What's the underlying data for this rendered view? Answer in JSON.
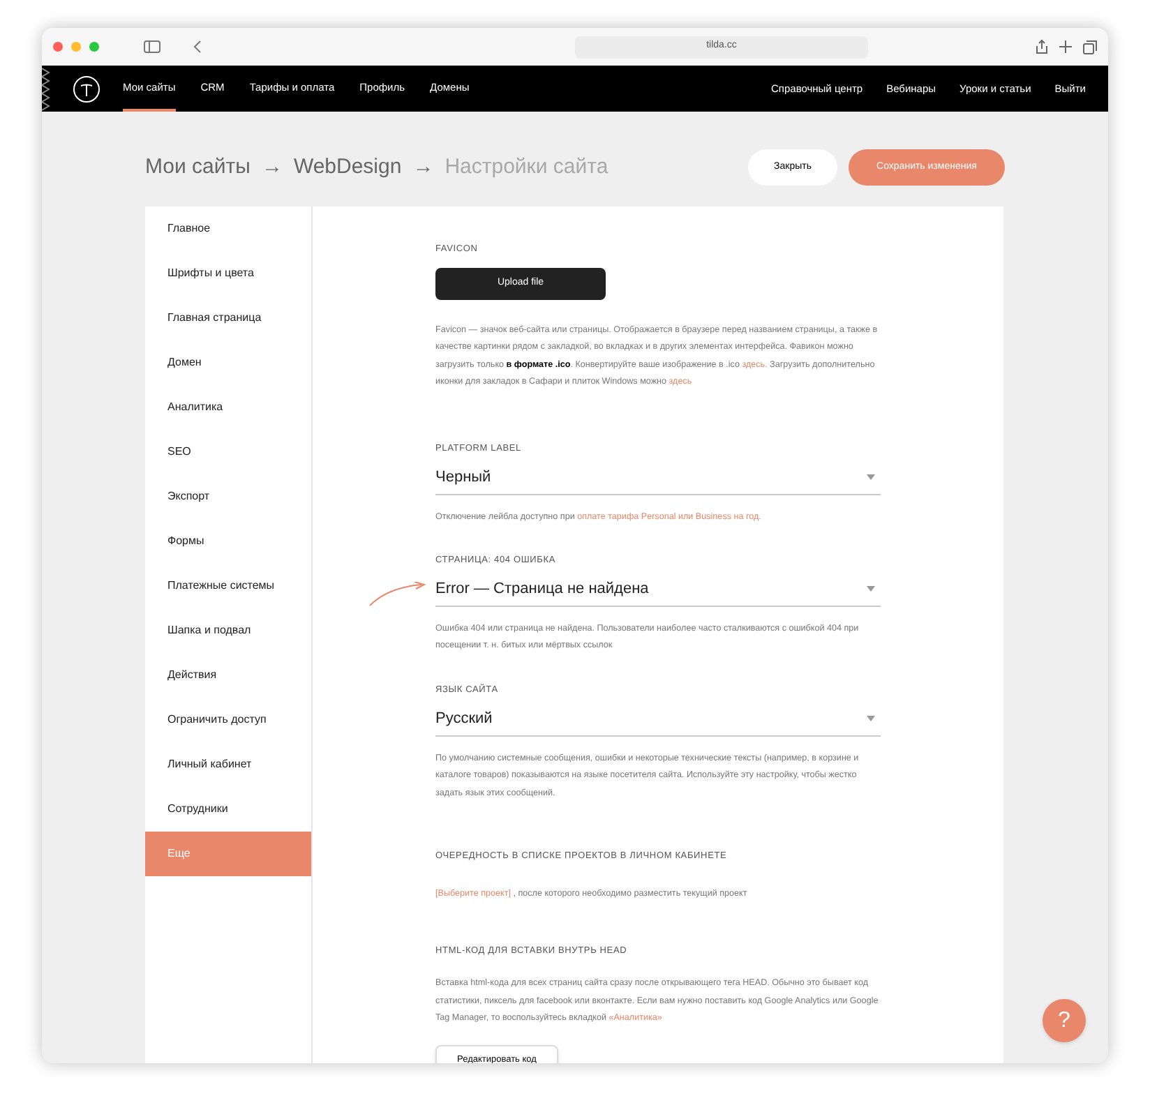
{
  "browser": {
    "url": "tilda.cc"
  },
  "nav": {
    "left": [
      {
        "label": "Мои сайты",
        "selected": true
      },
      {
        "label": "CRM",
        "selected": false
      },
      {
        "label": "Тарифы и оплата",
        "selected": false
      },
      {
        "label": "Профиль",
        "selected": false
      },
      {
        "label": "Домены",
        "selected": false
      }
    ],
    "right": [
      "Справочный центр",
      "Вебинары",
      "Уроки и статьи",
      "Выйти"
    ]
  },
  "breadcrumbs": [
    {
      "label": "Мои сайты",
      "current": false
    },
    {
      "label": "→",
      "current": false
    },
    {
      "label": "WebDesign",
      "current": false
    },
    {
      "label": "→",
      "current": false
    },
    {
      "label": "Настройки сайта",
      "current": true
    }
  ],
  "actions": {
    "close": "Закрыть",
    "save": "Сохранить изменения"
  },
  "sidebar": [
    {
      "label": "Главное",
      "selected": false
    },
    {
      "label": "Шрифты и цвета",
      "selected": false
    },
    {
      "label": "Главная страница",
      "selected": false
    },
    {
      "label": "Домен",
      "selected": false
    },
    {
      "label": "Аналитика",
      "selected": false
    },
    {
      "label": "SEO",
      "selected": false
    },
    {
      "label": "Экспорт",
      "selected": false
    },
    {
      "label": "Формы",
      "selected": false
    },
    {
      "label": "Платежные системы",
      "selected": false
    },
    {
      "label": "Шапка и подвал",
      "selected": false
    },
    {
      "label": "Действия",
      "selected": false
    },
    {
      "label": "Ограничить доступ",
      "selected": false
    },
    {
      "label": "Личный кабинет",
      "selected": false
    },
    {
      "label": "Сотрудники",
      "selected": false
    },
    {
      "label": "Еще",
      "selected": true
    }
  ],
  "sections": [
    {
      "kind": "upload",
      "heading": "FAVICON",
      "button": "Upload file",
      "note": [
        {
          "kind": "text",
          "text": "Favicon — значок веб-сайта или страницы. Отображается в браузере перед названием страницы, а также в качестве картинки рядом с закладкой, во вкладках и в других элементах интерфейса. Фавикон можно загрузить только "
        },
        {
          "kind": "bold",
          "text": "в формате .ico"
        },
        {
          "kind": "text",
          "text": ". Конвертируйте ваше изображение в .ico "
        },
        {
          "kind": "link",
          "text": "здесь."
        },
        {
          "kind": "text",
          "text": " Загрузить дополнительно иконки для закладок в Сафари и плиток Windows можно "
        },
        {
          "kind": "link",
          "text": "здесь"
        }
      ]
    },
    {
      "kind": "select",
      "heading": "PLATFORM LABEL",
      "value": "Черный",
      "highlighted": false,
      "note": [
        {
          "kind": "text",
          "text": "Отключение лейбла доступно при "
        },
        {
          "kind": "link",
          "text": "оплате тарифа Personal или Business на год."
        }
      ]
    },
    {
      "kind": "select",
      "heading": "СТРАНИЦА: 404 ОШИБКА",
      "value": "Error — Страница не найдена",
      "highlighted": true,
      "note": [
        {
          "kind": "text",
          "text": "Ошибка 404 или страница не найдена. Пользователи наиболее часто сталкиваются с ошибкой 404 при посещении т. н. битых или мёртвых ссылок"
        }
      ]
    },
    {
      "kind": "select",
      "heading": "ЯЗЫК САЙТА",
      "value": "Русский",
      "highlighted": false,
      "note": [
        {
          "kind": "text",
          "text": "По умолчанию системные сообщения, ошибки и некоторые технические тексты (например, в корзине и каталоге товаров) показываются на языке посетителя сайта. Используйте эту настройку, чтобы жестко задать язык этих сообщений."
        }
      ]
    },
    {
      "kind": "text",
      "heading": "ОЧЕРЕДНОСТЬ В СПИСКЕ ПРОЕКТОВ В ЛИЧНОМ КАБИНЕТЕ",
      "note": [
        {
          "kind": "link",
          "text": "[Выберите проект]"
        },
        {
          "kind": "text",
          "text": " , после которого необходимо разместить текущий проект"
        }
      ]
    },
    {
      "kind": "code",
      "heading": "HTML-КОД ДЛЯ ВСТАВКИ ВНУТРЬ HEAD",
      "note": [
        {
          "kind": "text",
          "text": "Вставка html-кода для всех страниц сайта сразу после открывающего тега HEAD. Обычно это бывает код статистики, пиксель для facebook или вконтакте. Если вам нужно поставить код Google Analytics или Google Tag Manager, то воспользуйтесь вкладкой "
        },
        {
          "kind": "link",
          "text": "«Аналитика»"
        }
      ],
      "button": "Редактировать код"
    }
  ],
  "help": "?"
}
